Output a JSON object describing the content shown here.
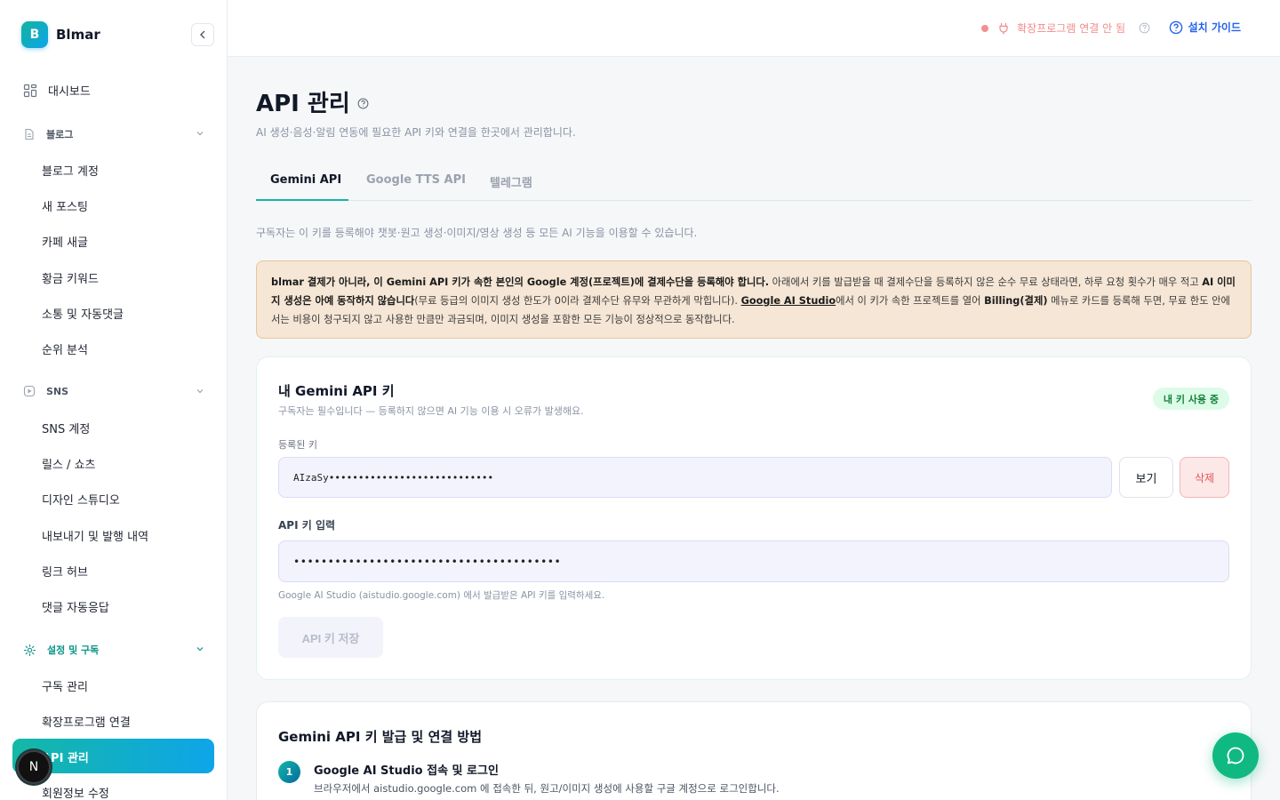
{
  "brand": {
    "logo_letter": "B",
    "name": "Blmar"
  },
  "sidebar": {
    "dashboard": "대시보드",
    "sections": [
      {
        "label": "블로그",
        "items": [
          "블로그 계정",
          "새 포스팅",
          "카페 새글",
          "황금 키워드",
          "소통 및 자동댓글",
          "순위 분석"
        ]
      },
      {
        "label": "SNS",
        "items": [
          "SNS 계정",
          "릴스 / 쇼츠",
          "디자인 스튜디오",
          "내보내기 및 발행 내역",
          "링크 허브",
          "댓글 자동응답"
        ]
      },
      {
        "label": "설정 및 구독",
        "items": [
          "구독 관리",
          "확장프로그램 연결",
          "API 관리",
          "회원정보 수정"
        ]
      }
    ],
    "active_item": "API 관리",
    "avatar_letter": "N"
  },
  "topbar": {
    "connection_status": "확장프로그램 연결 안 됨",
    "guide_label": "설치 가이드"
  },
  "page": {
    "title": "API 관리",
    "subtitle": "AI 생성·음성·알림 연동에 필요한 API 키와 연결을 한곳에서 관리합니다.",
    "tabs": [
      "Gemini API",
      "Google TTS API",
      "텔레그램"
    ],
    "active_tab": "Gemini API",
    "description": "구독자는 이 키를 등록해야 챗봇·원고 생성·이미지/영상 생성 등 모든 AI 기능을 이용할 수 있습니다."
  },
  "warning": {
    "bold1": "blmar 결제가 아니라, 이 Gemini API 키가 속한 본인의 Google 계정(프로젝트)에 결제수단을 등록해야 합니다.",
    "text1": " 아래에서 키를 발급받을 때 결제수단을 등록하지 않은 순수 무료 상태라면, 하루 요청 횟수가 매우 적고 ",
    "bold2": "AI 이미지 생성은 아예 동작하지 않습니다",
    "text2": "(무료 등급의 이미지 생성 한도가 0이라 결제수단 유무와 무관하게 막힙니다). ",
    "link": "Google AI Studio",
    "text3": "에서 이 키가 속한 프로젝트를 열어 ",
    "bold3": "Billing(결제)",
    "text4": " 메뉴로 카드를 등록해 두면, 무료 한도 안에서는 비용이 청구되지 않고 사용한 만큼만 과금되며, 이미지 생성을 포함한 모든 기능이 정상적으로 동작합니다."
  },
  "key_card": {
    "title": "내 Gemini API 키",
    "subtitle": "구독자는 필수입니다 — 등록하지 않으면 AI 기능 이용 시 오류가 발생해요.",
    "status_badge": "내 키 사용 중",
    "registered_label": "등록된 키",
    "registered_value": "AIzaSy••••••••••••••••••••••••••••",
    "view_button": "보기",
    "delete_button": "삭제",
    "input_label": "API 키 입력",
    "input_value": "•••••••••••••••••••••••••••••••••••••••",
    "hint": "Google AI Studio (aistudio.google.com) 에서 발급받은 API 키를 입력하세요.",
    "save_button": "API 키 저장"
  },
  "guide_card": {
    "title": "Gemini API 키 발급 및 연결 방법",
    "steps": [
      {
        "num": "1",
        "title": "Google AI Studio 접속 및 로그인",
        "desc": "브라우저에서 aistudio.google.com 에 접속한 뒤, 원고/이미지 생성에 사용할 구글 계정으로 로그인합니다."
      }
    ]
  },
  "colors": {
    "accent": "#14b8a6",
    "accent2": "#0ea5e9",
    "link": "#2563eb",
    "danger": "#ef4444"
  }
}
